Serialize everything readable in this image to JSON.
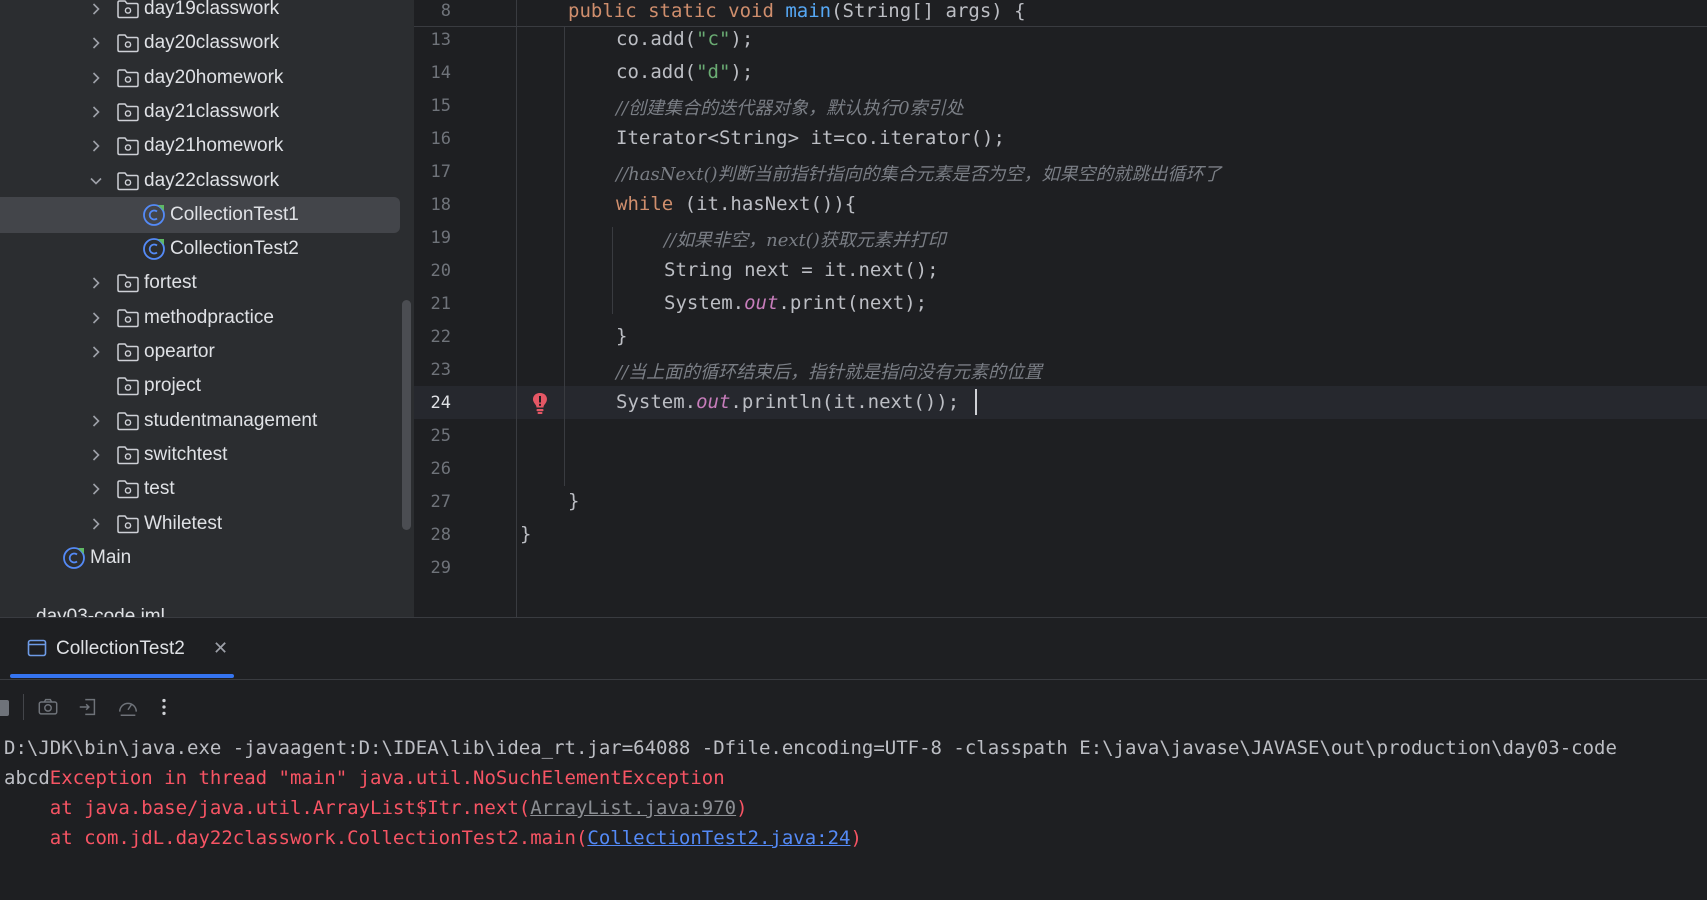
{
  "tree": {
    "items": [
      {
        "label": "day19classwork",
        "kind": "folder",
        "expanded": false,
        "indent": 1
      },
      {
        "label": "day20classwork",
        "kind": "folder",
        "expanded": false,
        "indent": 1
      },
      {
        "label": "day20homework",
        "kind": "folder",
        "expanded": false,
        "indent": 1
      },
      {
        "label": "day21classwork",
        "kind": "folder",
        "expanded": false,
        "indent": 1
      },
      {
        "label": "day21homework",
        "kind": "folder",
        "expanded": false,
        "indent": 1
      },
      {
        "label": "day22classwork",
        "kind": "folder",
        "expanded": true,
        "indent": 1
      },
      {
        "label": "CollectionTest1",
        "kind": "class",
        "selected": true,
        "indent": 2
      },
      {
        "label": "CollectionTest2",
        "kind": "class",
        "indent": 2
      },
      {
        "label": "fortest",
        "kind": "folder",
        "expanded": false,
        "indent": 1
      },
      {
        "label": "methodpractice",
        "kind": "folder",
        "expanded": false,
        "indent": 1
      },
      {
        "label": "opeartor",
        "kind": "folder",
        "expanded": false,
        "indent": 1
      },
      {
        "label": "project",
        "kind": "folder-noexpand",
        "indent": 1
      },
      {
        "label": "studentmanagement",
        "kind": "folder",
        "expanded": false,
        "indent": 1
      },
      {
        "label": "switchtest",
        "kind": "folder",
        "expanded": false,
        "indent": 1
      },
      {
        "label": "test",
        "kind": "folder",
        "expanded": false,
        "indent": 1
      },
      {
        "label": "Whiletest",
        "kind": "folder",
        "expanded": false,
        "indent": 1
      },
      {
        "label": "Main",
        "kind": "class",
        "indent": 0
      }
    ],
    "partial_label": "day03-code.iml"
  },
  "editor": {
    "sticky": {
      "num": "8",
      "code": "public static void main(String[] args) {"
    },
    "lines": [
      {
        "num": "13"
      },
      {
        "num": "14"
      },
      {
        "num": "15"
      },
      {
        "num": "16"
      },
      {
        "num": "17"
      },
      {
        "num": "18"
      },
      {
        "num": "19"
      },
      {
        "num": "20"
      },
      {
        "num": "21"
      },
      {
        "num": "22"
      },
      {
        "num": "23"
      },
      {
        "num": "24"
      },
      {
        "num": "25"
      },
      {
        "num": "26"
      },
      {
        "num": "27"
      },
      {
        "num": "28"
      },
      {
        "num": "29"
      }
    ],
    "tokens": {
      "l13": [
        "co.add(",
        "\"c\"",
        ");"
      ],
      "l14": [
        "co.add(",
        "\"d\"",
        ");"
      ],
      "l15": "//创建集合的迭代器对象，默认执行0索引处",
      "l16": "Iterator<String> it=co.iterator();",
      "l17": "//hasNext()判断当前指针指向的集合元素是否为空，如果空的就跳出循环了",
      "l18": [
        "while",
        " (it.hasNext()){"
      ],
      "l19": "//如果非空，next()获取元素并打印",
      "l20": "String next = it.next();",
      "l21": [
        "System.",
        "out",
        ".print(next);"
      ],
      "l22": "}",
      "l23": "//当上面的循环结束后，指针就是指向没有元素的位置",
      "l24": [
        "System.",
        "out",
        ".println(it.next());"
      ],
      "l27": "}",
      "l28": "}"
    },
    "sticky_tokens": [
      "public static void ",
      "main",
      "(String[] args) {"
    ],
    "current_line": "24"
  },
  "run": {
    "tab_label": "CollectionTest2",
    "console": {
      "cmd": "D:\\JDK\\bin\\java.exe -javaagent:D:\\IDEA\\lib\\idea_rt.jar=64088 -Dfile.encoding=UTF-8 -classpath E:\\java\\javase\\JAVASE\\out\\production\\day03-code",
      "output_prefix": "abcd",
      "exception": "Exception in thread \"main\" java.util.NoSuchElementException",
      "trace1_pre": "    at java.base/java.util.ArrayList$Itr.next(",
      "trace1_link": "ArrayList.java:970",
      "trace1_post": ")",
      "trace2_pre": "    at com.jdL.day22classwork.CollectionTest2.main(",
      "trace2_link": "CollectionTest2.java:24",
      "trace2_post": ")"
    }
  },
  "colors": {
    "accent": "#3574f0",
    "error": "#f75464",
    "keyword": "#cf8e6d",
    "string": "#6aab73",
    "comment": "#7a7e85",
    "field": "#c77dbb"
  }
}
